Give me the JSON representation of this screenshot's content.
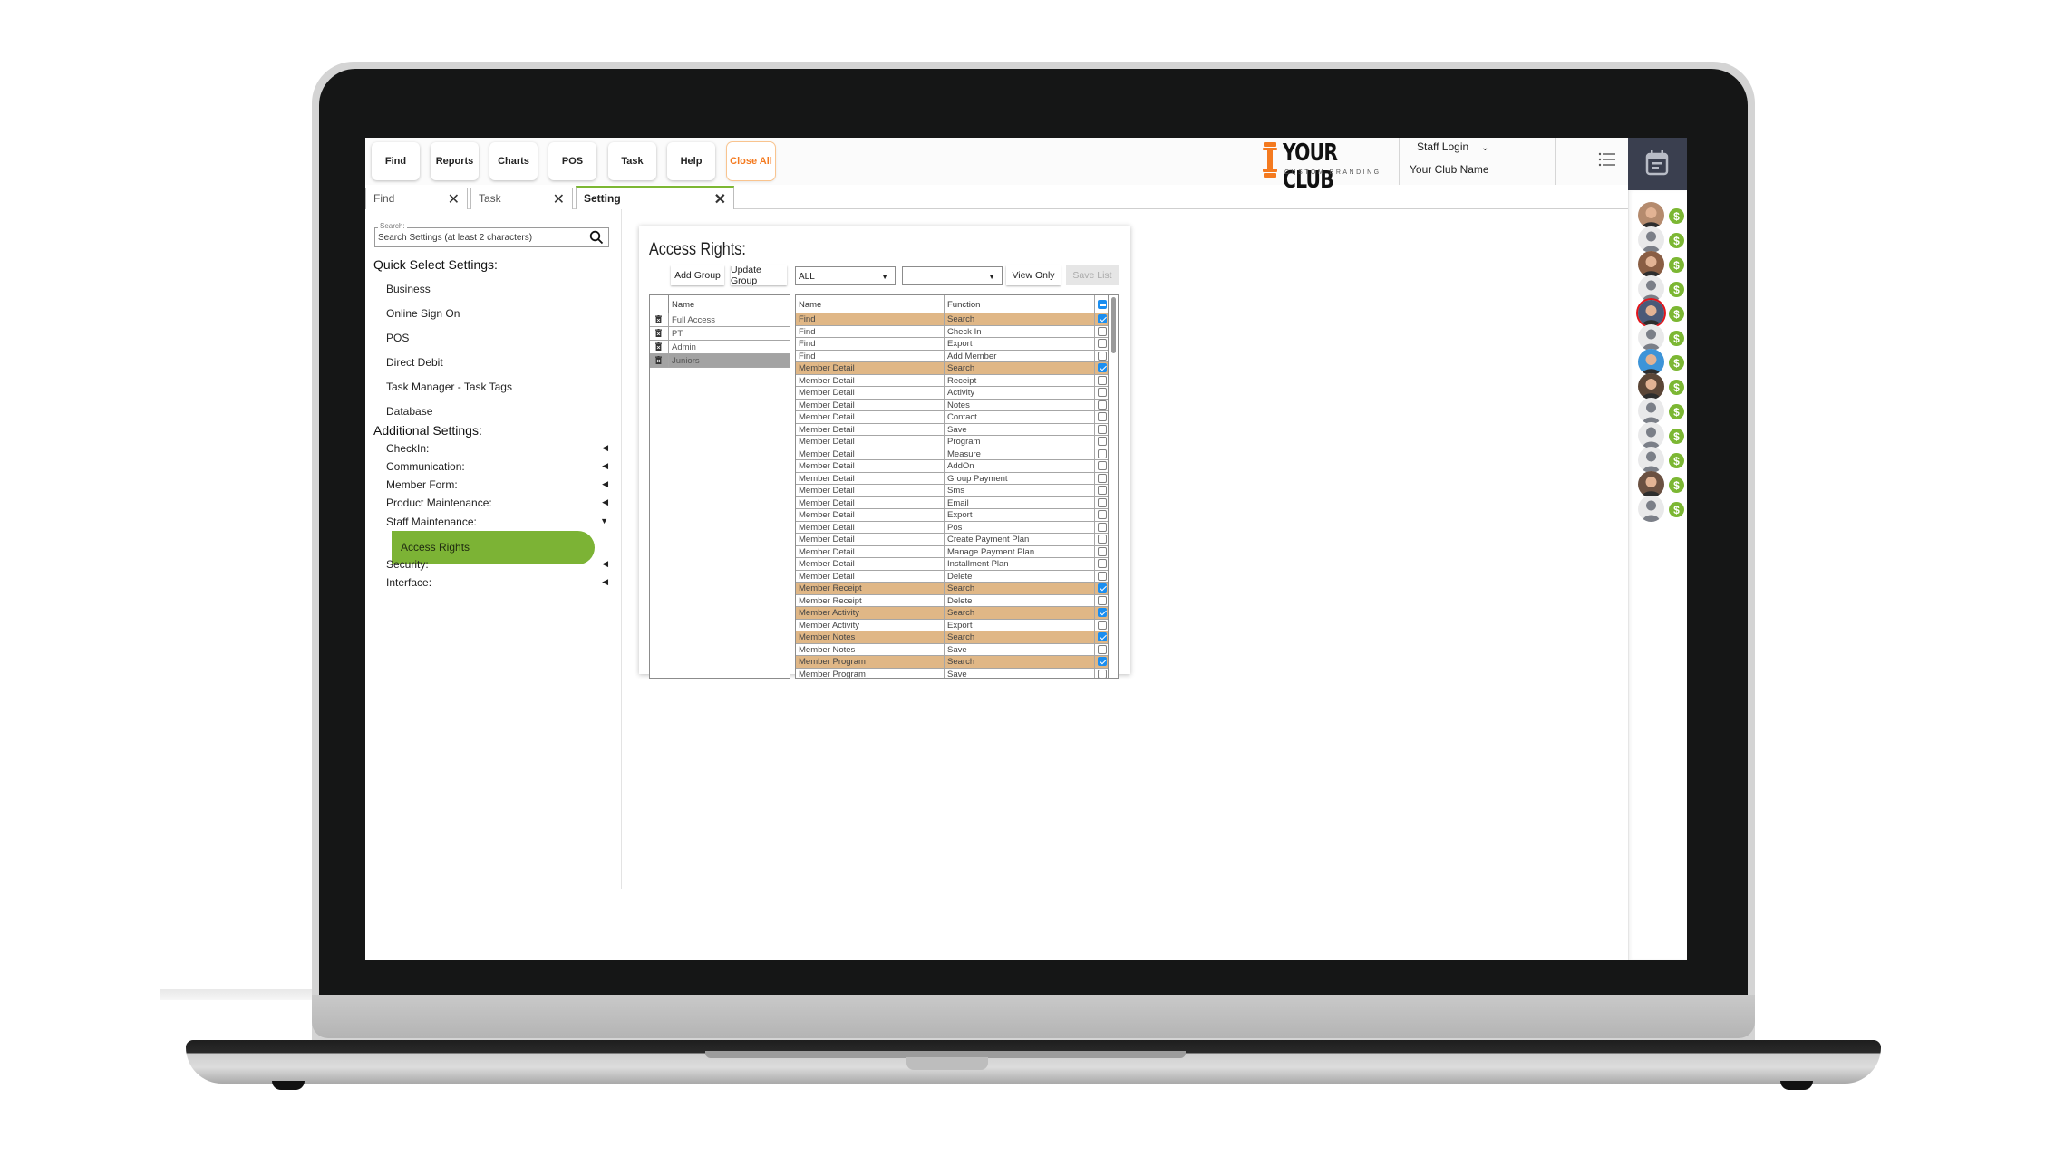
{
  "toolbar": {
    "buttons": [
      {
        "label": "Find"
      },
      {
        "label": "Reports"
      },
      {
        "label": "Charts"
      },
      {
        "label": "POS"
      },
      {
        "label": "Task"
      },
      {
        "label": "Help"
      },
      {
        "label": "Close All"
      }
    ],
    "brand": {
      "name": "YOUR CLUB",
      "tagline": "CUSTOM BRANDING",
      "accent": "#f47a1f"
    },
    "staff_login": "Staff Login",
    "club_name": "Your Club Name",
    "menu_icon": "list-menu-icon",
    "calendar_icon": "calendar-icon"
  },
  "tabs": [
    {
      "label": "Find",
      "active": false
    },
    {
      "label": "Task",
      "active": false
    },
    {
      "label": "Setting",
      "active": true
    }
  ],
  "sidebar": {
    "search": {
      "label": "Search:",
      "placeholder": "Search Settings (at least 2 characters)",
      "value": ""
    },
    "quick_heading": "Quick Select Settings:",
    "quick_items": [
      "Business",
      "Online Sign On",
      "POS",
      "Direct Debit",
      "Task Manager - Task Tags",
      "Database"
    ],
    "additional_heading": "Additional Settings:",
    "additional_items": [
      {
        "label": "CheckIn:",
        "expanded": false
      },
      {
        "label": "Communication:",
        "expanded": false
      },
      {
        "label": "Member Form:",
        "expanded": false
      },
      {
        "label": "Product Maintenance:",
        "expanded": false
      },
      {
        "label": "Staff Maintenance:",
        "expanded": true
      },
      {
        "label": "Security:",
        "expanded": false
      },
      {
        "label": "Interface:",
        "expanded": false
      }
    ],
    "active_sub_item": "Access Rights",
    "accent": "#7cb335"
  },
  "access_rights": {
    "title": "Access Rights:",
    "buttons": {
      "add_group": "Add Group",
      "update_group": "Update Group",
      "view_only": "View Only",
      "save_list": "Save List"
    },
    "filter1": "ALL",
    "filter2": "",
    "groups_header": "Name",
    "groups": [
      {
        "name": "Full Access",
        "selected": false
      },
      {
        "name": "PT",
        "selected": false
      },
      {
        "name": "Admin",
        "selected": false
      },
      {
        "name": "Juniors",
        "selected": true
      }
    ],
    "functions_header": {
      "name": "Name",
      "function": "Function"
    },
    "highlight_color": "#e0b786",
    "check_color": "#1b8ef0",
    "functions": [
      {
        "name": "Find",
        "function": "Search",
        "checked": true
      },
      {
        "name": "Find",
        "function": "Check In",
        "checked": false
      },
      {
        "name": "Find",
        "function": "Export",
        "checked": false
      },
      {
        "name": "Find",
        "function": "Add Member",
        "checked": false
      },
      {
        "name": "Member Detail",
        "function": "Search",
        "checked": true
      },
      {
        "name": "Member Detail",
        "function": "Receipt",
        "checked": false
      },
      {
        "name": "Member Detail",
        "function": "Activity",
        "checked": false
      },
      {
        "name": "Member Detail",
        "function": "Notes",
        "checked": false
      },
      {
        "name": "Member Detail",
        "function": "Contact",
        "checked": false
      },
      {
        "name": "Member Detail",
        "function": "Save",
        "checked": false
      },
      {
        "name": "Member Detail",
        "function": "Program",
        "checked": false
      },
      {
        "name": "Member Detail",
        "function": "Measure",
        "checked": false
      },
      {
        "name": "Member Detail",
        "function": "AddOn",
        "checked": false
      },
      {
        "name": "Member Detail",
        "function": "Group Payment",
        "checked": false
      },
      {
        "name": "Member Detail",
        "function": "Sms",
        "checked": false
      },
      {
        "name": "Member Detail",
        "function": "Email",
        "checked": false
      },
      {
        "name": "Member Detail",
        "function": "Export",
        "checked": false
      },
      {
        "name": "Member Detail",
        "function": "Pos",
        "checked": false
      },
      {
        "name": "Member Detail",
        "function": "Create Payment Plan",
        "checked": false
      },
      {
        "name": "Member Detail",
        "function": "Manage Payment Plan",
        "checked": false
      },
      {
        "name": "Member Detail",
        "function": "Installment Plan",
        "checked": false
      },
      {
        "name": "Member Detail",
        "function": "Delete",
        "checked": false
      },
      {
        "name": "Member Receipt",
        "function": "Search",
        "checked": true
      },
      {
        "name": "Member Receipt",
        "function": "Delete",
        "checked": false
      },
      {
        "name": "Member Activity",
        "function": "Search",
        "checked": true
      },
      {
        "name": "Member Activity",
        "function": "Export",
        "checked": false
      },
      {
        "name": "Member Notes",
        "function": "Search",
        "checked": true
      },
      {
        "name": "Member Notes",
        "function": "Save",
        "checked": false
      },
      {
        "name": "Member Program",
        "function": "Search",
        "checked": true
      },
      {
        "name": "Member Program",
        "function": "Save",
        "checked": false
      }
    ]
  },
  "rail": {
    "members": [
      {
        "avatar": "photo",
        "tone": "#b58b6e",
        "ring": false
      },
      {
        "avatar": "placeholder",
        "ring": false
      },
      {
        "avatar": "photo",
        "tone": "#8a5e44",
        "ring": false
      },
      {
        "avatar": "placeholder",
        "ring": false
      },
      {
        "avatar": "photo",
        "tone": "#4a5a78",
        "ring": true
      },
      {
        "avatar": "placeholder",
        "ring": false
      },
      {
        "avatar": "photo",
        "tone": "#3d94d8",
        "ring": false
      },
      {
        "avatar": "photo",
        "tone": "#5b4637",
        "ring": false
      },
      {
        "avatar": "placeholder",
        "ring": false
      },
      {
        "avatar": "placeholder",
        "ring": false
      },
      {
        "avatar": "placeholder",
        "ring": false
      },
      {
        "avatar": "photo",
        "tone": "#6b5142",
        "ring": false
      },
      {
        "avatar": "placeholder",
        "ring": false
      }
    ],
    "badge_symbol": "$",
    "badge_color": "#7cb733"
  }
}
